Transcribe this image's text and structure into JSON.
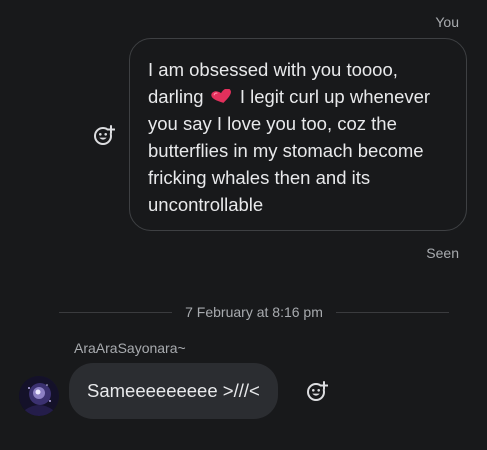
{
  "outgoing": {
    "sender_label": "You",
    "text_before_emoji": "I am obsessed with you toooo, darling",
    "emoji": "pink-heart-emoji",
    "text_after_emoji": "I legit curl up whenever you say I love you too, coz the butterflies in my stomach become fricking whales then and its uncontrollable",
    "status": "Seen"
  },
  "date_divider": "7 February at 8:16 pm",
  "incoming": {
    "sender_name": "AraAraSayonara~",
    "text": "Sameeeeeeeee >///<"
  },
  "colors": {
    "background": "#18191b",
    "incoming_bubble": "#2b2d31",
    "outgoing_border": "#3e4043",
    "meta_text": "#a8abaf",
    "heart": "#e2305c"
  },
  "icons": {
    "react": "add-reaction-icon"
  }
}
